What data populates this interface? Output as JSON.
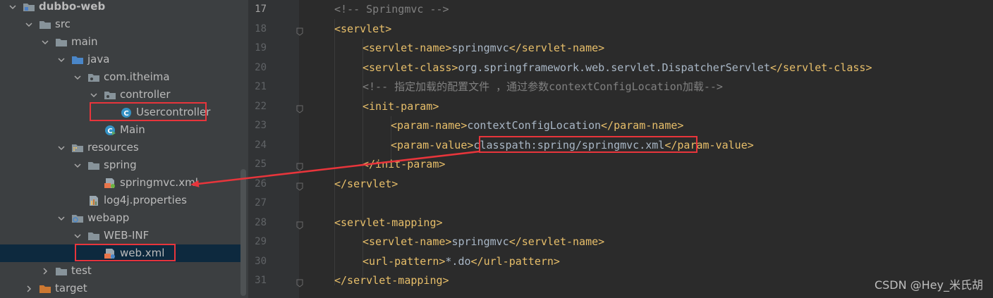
{
  "project_tree": {
    "items": [
      {
        "label": "dubbo-web",
        "icon": "module-folder-icon",
        "expanded": true
      },
      {
        "label": "src",
        "icon": "folder-icon",
        "expanded": true
      },
      {
        "label": "main",
        "icon": "folder-icon",
        "expanded": true
      },
      {
        "label": "java",
        "icon": "source-folder-icon",
        "expanded": true
      },
      {
        "label": "com.itheima",
        "icon": "package-icon",
        "expanded": true
      },
      {
        "label": "controller",
        "icon": "package-icon",
        "expanded": true
      },
      {
        "label": "Usercontroller",
        "icon": "java-class-icon"
      },
      {
        "label": "Main",
        "icon": "java-main-class-icon"
      },
      {
        "label": "resources",
        "icon": "resources-folder-icon",
        "expanded": true
      },
      {
        "label": "spring",
        "icon": "folder-icon",
        "expanded": true
      },
      {
        "label": "springmvc.xml",
        "icon": "spring-xml-icon"
      },
      {
        "label": "log4j.properties",
        "icon": "properties-file-icon"
      },
      {
        "label": "webapp",
        "icon": "web-folder-icon",
        "expanded": true
      },
      {
        "label": "WEB-INF",
        "icon": "folder-icon",
        "expanded": true
      },
      {
        "label": "web.xml",
        "icon": "web-xml-icon",
        "selected": true
      },
      {
        "label": "test",
        "icon": "folder-icon",
        "expanded": false
      },
      {
        "label": "target",
        "icon": "excluded-folder-icon",
        "expanded": false
      }
    ]
  },
  "editor": {
    "line_numbers": [
      "17",
      "18",
      "19",
      "20",
      "21",
      "22",
      "23",
      "24",
      "25",
      "26",
      "27",
      "28",
      "29",
      "30",
      "31"
    ],
    "lines": [
      {
        "indent": 1,
        "tokens": [
          {
            "t": "cmt",
            "v": "<!-- Springmvc -->"
          }
        ]
      },
      {
        "indent": 1,
        "tokens": [
          {
            "t": "tag",
            "v": "<servlet>"
          }
        ]
      },
      {
        "indent": 2,
        "tokens": [
          {
            "t": "tag",
            "v": "<servlet-name>"
          },
          {
            "t": "txt",
            "v": "springmvc"
          },
          {
            "t": "tag",
            "v": "</servlet-name>"
          }
        ]
      },
      {
        "indent": 2,
        "tokens": [
          {
            "t": "tag",
            "v": "<servlet-class>"
          },
          {
            "t": "txt",
            "v": "org.springframework.web.servlet.DispatcherServlet"
          },
          {
            "t": "tag",
            "v": "</servlet-class>"
          }
        ]
      },
      {
        "indent": 2,
        "tokens": [
          {
            "t": "cmt",
            "v": "<!-- 指定加载的配置文件 ，通过参数contextConfigLocation加载-->"
          }
        ]
      },
      {
        "indent": 2,
        "tokens": [
          {
            "t": "tag",
            "v": "<init-param>"
          }
        ]
      },
      {
        "indent": 3,
        "tokens": [
          {
            "t": "tag",
            "v": "<param-name>"
          },
          {
            "t": "txt",
            "v": "contextConfigLocation"
          },
          {
            "t": "tag",
            "v": "</param-name>"
          }
        ]
      },
      {
        "indent": 3,
        "tokens": [
          {
            "t": "tag",
            "v": "<param-value>"
          },
          {
            "t": "txt",
            "v": "classpath:spring/springmvc.xml"
          },
          {
            "t": "tag",
            "v": "</param-value>"
          }
        ]
      },
      {
        "indent": 2,
        "tokens": [
          {
            "t": "tag",
            "v": "</init-param>"
          }
        ]
      },
      {
        "indent": 1,
        "tokens": [
          {
            "t": "tag",
            "v": "</servlet>"
          }
        ]
      },
      {
        "indent": 0,
        "tokens": []
      },
      {
        "indent": 1,
        "tokens": [
          {
            "t": "tag",
            "v": "<servlet-mapping>"
          }
        ]
      },
      {
        "indent": 2,
        "tokens": [
          {
            "t": "tag",
            "v": "<servlet-name>"
          },
          {
            "t": "txt",
            "v": "springmvc"
          },
          {
            "t": "tag",
            "v": "</servlet-name>"
          }
        ]
      },
      {
        "indent": 2,
        "tokens": [
          {
            "t": "tag",
            "v": "<url-pattern>"
          },
          {
            "t": "txt",
            "v": "*.do"
          },
          {
            "t": "tag",
            "v": "</url-pattern>"
          }
        ]
      },
      {
        "indent": 1,
        "tokens": [
          {
            "t": "tag",
            "v": "</servlet-mapping>"
          }
        ]
      }
    ]
  },
  "watermark": "CSDN @Hey_米氏胡",
  "colors": {
    "tag": "#e8bf6a",
    "text": "#a9b7c6",
    "comment": "#808080",
    "annotation": "#e8353b"
  }
}
